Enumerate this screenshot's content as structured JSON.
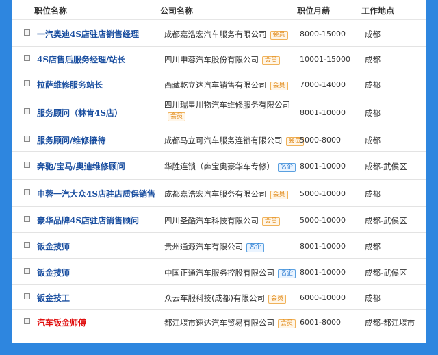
{
  "header": {
    "job": "职位名称",
    "company": "公司名称",
    "salary": "职位月薪",
    "location": "工作地点"
  },
  "rows": [
    {
      "job": "一汽奥迪4S店驻店销售经理",
      "company": "成都嘉浩宏汽车服务有限公司",
      "badge": "会员",
      "badge_type": "member",
      "salary": "8000-15000",
      "location": "成都"
    },
    {
      "job": "4S店售后服务经理/站长",
      "company": "四川申蓉汽车股份有限公司",
      "badge": "会员",
      "badge_type": "member",
      "salary": "10001-15000",
      "location": "成都"
    },
    {
      "job": "拉萨维修服务站长",
      "company": "西藏乾立达汽车销售有限公司",
      "badge": "会员",
      "badge_type": "member",
      "salary": "7000-14000",
      "location": "成都"
    },
    {
      "job": "服务顾问（林肯4S店）",
      "company": "四川瑞星川物汽车维修服务有限公司",
      "badge": "会员",
      "badge_type": "member",
      "salary": "8001-10000",
      "location": "成都"
    },
    {
      "job": "服务顾问/维修接待",
      "company": "成都马立可汽车服务连锁有限公司",
      "badge": "会员",
      "badge_type": "member",
      "salary": "5000-8000",
      "location": "成都"
    },
    {
      "job": "奔驰/宝马/奥迪维修顾问",
      "company": "华胜连锁（奔宝奥豪华车专修）",
      "badge": "名企",
      "badge_type": "famous",
      "salary": "8001-10000",
      "location": "成都-武侯区"
    },
    {
      "job": "申蓉一汽大众4S店驻店质保销售",
      "company": "成都嘉浩宏汽车服务有限公司",
      "badge": "会员",
      "badge_type": "member",
      "salary": "5000-10000",
      "location": "成都"
    },
    {
      "job": "豪华品牌4S店驻店销售顾问",
      "company": "四川圣酷汽车科技有限公司",
      "badge": "会员",
      "badge_type": "member",
      "salary": "5000-10000",
      "location": "成都-武侯区"
    },
    {
      "job": "钣金技师",
      "company": "贵州通源汽车有限公司",
      "badge": "名企",
      "badge_type": "famous",
      "salary": "8001-10000",
      "location": "成都"
    },
    {
      "job": "钣金技师",
      "company": "中国正通汽车服务控股有限公司",
      "badge": "名企",
      "badge_type": "famous",
      "salary": "8001-10000",
      "location": "成都-武侯区"
    },
    {
      "job": "钣金技工",
      "company": "众云车服科技(成都)有限公司",
      "badge": "会员",
      "badge_type": "member",
      "salary": "6000-10000",
      "location": "成都"
    },
    {
      "job": "汽车钣金师傅",
      "company": "都江堰市速达汽车贸易有限公司",
      "badge": "会员",
      "badge_type": "member",
      "salary": "6001-8000",
      "location": "成都-都江堰市"
    }
  ]
}
